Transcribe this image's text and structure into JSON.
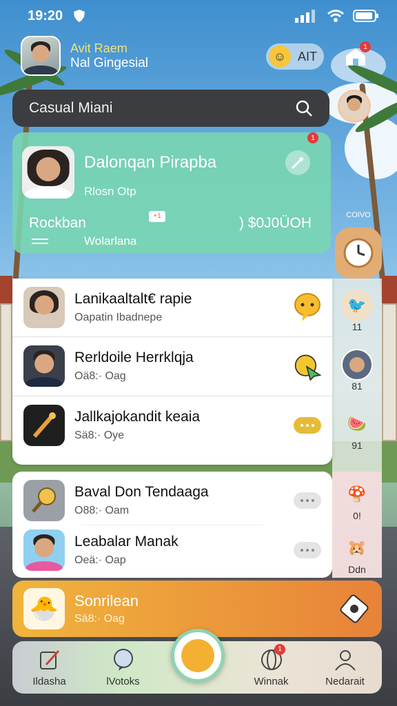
{
  "status": {
    "time": "19:20"
  },
  "profile": {
    "name": "Avit Raem",
    "subtitle": "Nal Gingesial"
  },
  "top": {
    "pill_label": "AIT",
    "notif_count": "1"
  },
  "search": {
    "placeholder": "Casual Miani"
  },
  "feature": {
    "title": "Dalonqan Pirapba",
    "subtitle": "Rlosn Otp",
    "badge": "1",
    "left_label": "Rockban",
    "mini_tag": "+1",
    "amount": ") $0J0ÜOH",
    "bottom_label": "Wolarlana",
    "side_caption": "COIVO"
  },
  "chats": [
    {
      "name": "Lanikaaltalt€ rapie",
      "meta": "Oapatin Ibadnepe",
      "action": "chat-bubble-icon"
    },
    {
      "name": "Rerldoile Herrklqja",
      "meta": "Oä8:· Oag",
      "action": "pointer-icon"
    },
    {
      "name": "Jallkajokandit keaia",
      "meta": "Sä8:· Oye",
      "action": "more-icon"
    },
    {
      "name": "Baval Don Tendaaga",
      "meta": "O88:· Oam",
      "action": "more-icon"
    },
    {
      "name": "Leabalar Manak",
      "meta": "Oeä:· Oap",
      "action": "more-icon"
    }
  ],
  "rail": [
    {
      "label": "11",
      "icon": "bird-icon"
    },
    {
      "label": "81",
      "icon": "person-icon"
    },
    {
      "label": "91",
      "icon": "fruit-icon"
    },
    {
      "label": "0!",
      "icon": "mushroom-icon"
    },
    {
      "label": "Ddn",
      "icon": "pet-icon"
    }
  ],
  "promo": {
    "title": "Sonrilean",
    "meta": "Sä8:· Oag"
  },
  "nav": [
    {
      "label": "Ildasha",
      "icon": "edit-icon"
    },
    {
      "label": "lVotoks",
      "icon": "chat-icon"
    },
    {
      "label": "Winnak",
      "icon": "globe-icon",
      "badge": "1"
    },
    {
      "label": "Nedarait",
      "icon": "user-icon"
    }
  ],
  "colors": {
    "feature": "#79d6b1",
    "promo": "#f0b43c",
    "accent": "#e53a3a"
  }
}
